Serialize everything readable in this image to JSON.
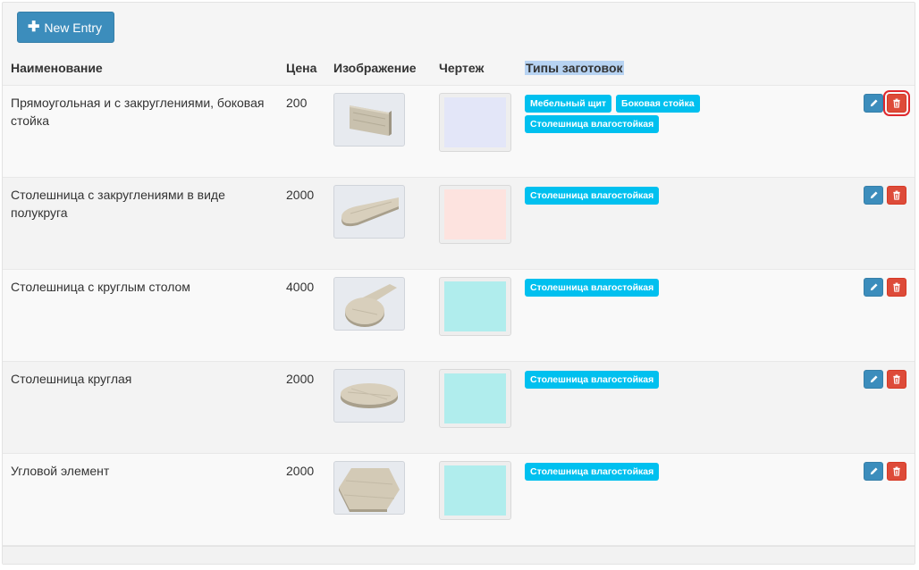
{
  "toolbar": {
    "new_label": "New Entry",
    "new_icon": "plus-icon"
  },
  "columns": {
    "name": "Наименование",
    "price": "Цена",
    "image": "Изображение",
    "drawing": "Чертеж",
    "types": "Типы заготовок"
  },
  "colors": {
    "primary": "#3c8dbc",
    "danger": "#dd4b39",
    "tag": "#00c0ef",
    "selection_highlight": "#b7d3f2"
  },
  "rows": [
    {
      "name": "Прямоугольная и с закруглениями, боковая стойка",
      "price": "200",
      "image_icon": "rectangular-board-image",
      "drawing_color": "#e3e6f8",
      "tags": [
        "Мебельный щит",
        "Боковая стойка",
        "Столешница влагостойкая"
      ]
    },
    {
      "name": "Столешница с закруглениями в виде полукруга",
      "price": "2000",
      "image_icon": "rounded-countertop-image",
      "drawing_color": "#fde3df",
      "tags": [
        "Столешница влагостойкая"
      ]
    },
    {
      "name": "Столешница с круглым столом",
      "price": "4000",
      "image_icon": "countertop-round-table-image",
      "drawing_color": "#b0eded",
      "tags": [
        "Столешница влагостойкая"
      ]
    },
    {
      "name": "Столешница круглая",
      "price": "2000",
      "image_icon": "round-countertop-image",
      "drawing_color": "#b0eded",
      "tags": [
        "Столешница влагостойкая"
      ]
    },
    {
      "name": "Угловой элемент",
      "price": "2000",
      "image_icon": "corner-element-image",
      "drawing_color": "#b0eded",
      "tags": [
        "Столешница влагостойкая"
      ]
    }
  ],
  "actions": {
    "edit_icon": "pencil-icon",
    "delete_icon": "trash-icon"
  }
}
